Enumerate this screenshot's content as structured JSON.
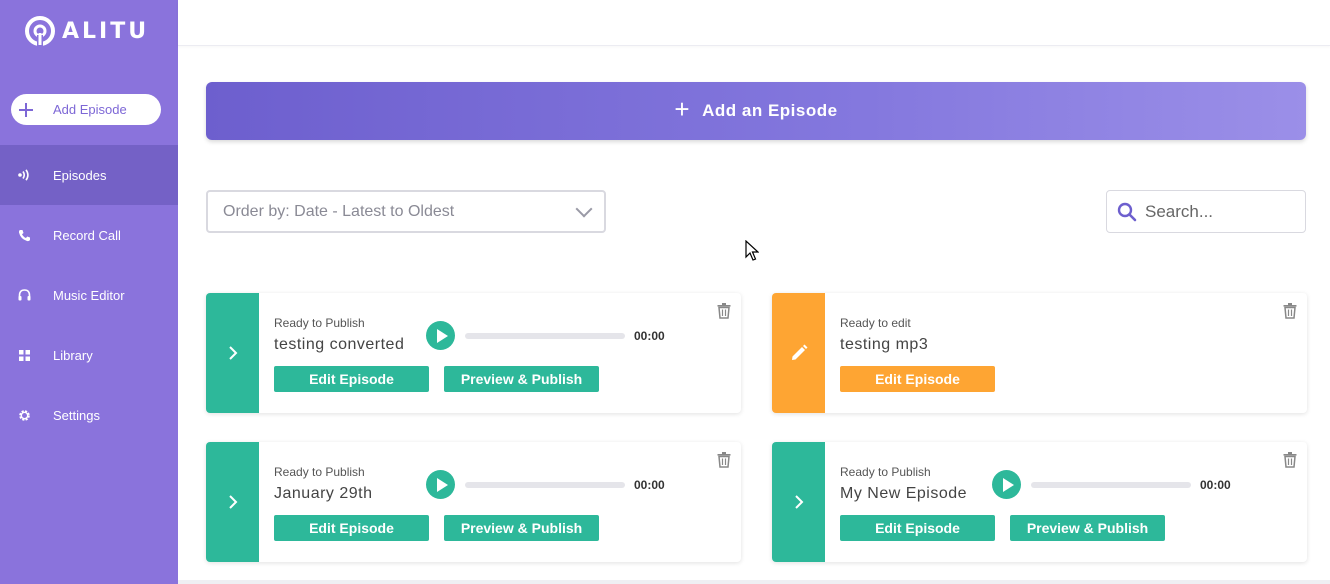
{
  "app": {
    "logo_text": "ALITU"
  },
  "sidebar": {
    "add_episode_label": "Add Episode",
    "items": [
      {
        "label": "Episodes",
        "icon": "broadcast-icon",
        "active": true
      },
      {
        "label": "Record Call",
        "icon": "phone-icon",
        "active": false
      },
      {
        "label": "Music Editor",
        "icon": "headphones-icon",
        "active": false
      },
      {
        "label": "Library",
        "icon": "grid-icon",
        "active": false
      },
      {
        "label": "Settings",
        "icon": "gear-icon",
        "active": false
      }
    ]
  },
  "main": {
    "banner_label": "Add an Episode",
    "order_select_value": "Order by: Date - Latest to Oldest",
    "search_placeholder": "Search..."
  },
  "episodes": [
    {
      "status": "Ready to Publish",
      "title": "testing converted",
      "time": "00:00",
      "edit_label": "Edit Episode",
      "publish_label": "Preview & Publish",
      "color": "green",
      "progress": 0
    },
    {
      "status": "Ready to edit",
      "title": "testing mp3",
      "edit_label": "Edit Episode",
      "color": "orange"
    },
    {
      "status": "Ready to Publish",
      "title": "January 29th",
      "time": "00:00",
      "edit_label": "Edit Episode",
      "publish_label": "Preview & Publish",
      "color": "green",
      "progress": 0
    },
    {
      "status": "Ready to Publish",
      "title": "My New Episode",
      "time": "00:00",
      "edit_label": "Edit Episode",
      "publish_label": "Preview & Publish",
      "color": "green",
      "progress": 0
    }
  ],
  "colors": {
    "sidebar": "#8a73dc",
    "sidebar_active": "#7461c6",
    "green": "#2db89a",
    "orange": "#fea533"
  }
}
